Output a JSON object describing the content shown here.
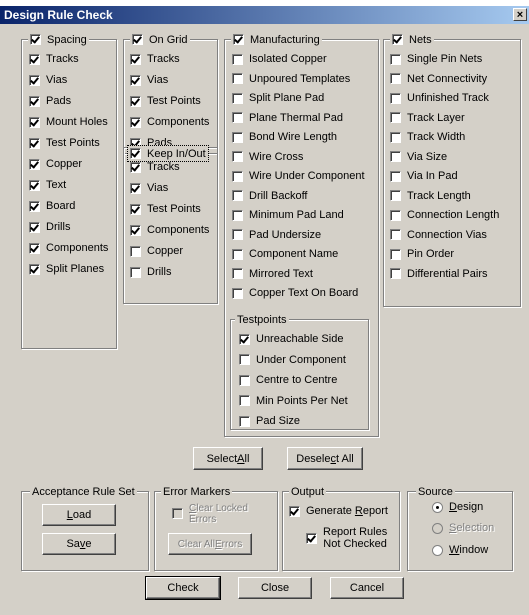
{
  "title": "Design Rule Check",
  "close_glyph": "×",
  "spacing": {
    "header": "Spacing",
    "items": [
      "Tracks",
      "Vias",
      "Pads",
      "Mount Holes",
      "Test Points",
      "Copper",
      "Text",
      "Board",
      "Drills",
      "Components",
      "Split Planes"
    ]
  },
  "ongrid": {
    "header": "On Grid",
    "items": [
      "Tracks",
      "Vias",
      "Test Points",
      "Components",
      "Pads"
    ]
  },
  "keepin": {
    "header": "Keep In/Out",
    "items": [
      "Tracks",
      "Vias",
      "Test Points",
      "Components",
      "Copper",
      "Drills"
    ],
    "checked": [
      true,
      true,
      true,
      true,
      false,
      false
    ]
  },
  "manufacturing": {
    "header": "Manufacturing",
    "items": [
      "Isolated Copper",
      "Unpoured Templates",
      "Split Plane Pad",
      "Plane Thermal Pad",
      "Bond Wire Length",
      "Wire Cross",
      "Wire Under Component",
      "Drill Backoff",
      "Minimum Pad Land",
      "Pad Undersize",
      "Component Name",
      "Mirrored Text",
      "Copper Text On Board"
    ]
  },
  "testpoints": {
    "header": "Testpoints",
    "items": [
      "Unreachable Side",
      "Under Component",
      "Centre to Centre",
      "Min Points Per Net",
      "Pad Size"
    ],
    "checked": [
      true,
      false,
      false,
      false,
      false
    ]
  },
  "nets": {
    "header": "Nets",
    "items": [
      "Single Pin Nets",
      "Net Connectivity",
      "Unfinished Track",
      "Track Layer",
      "Track Width",
      "Via Size",
      "Via In Pad",
      "Track Length",
      "Connection Length",
      "Connection Vias",
      "Pin Order",
      "Differential Pairs"
    ]
  },
  "select_all": {
    "pre": "Select ",
    "u": "A",
    "post": "ll"
  },
  "deselect_all": {
    "pre": "Desele",
    "u": "c",
    "post": "t All"
  },
  "acceptance": {
    "header": "Acceptance Rule Set",
    "load": {
      "u": "L",
      "post": "oad"
    },
    "save": {
      "pre": "Sa",
      "u": "v",
      "post": "e"
    }
  },
  "error_markers": {
    "header": "Error Markers",
    "clear_locked": {
      "u": "C",
      "post1": "lear Locked",
      "line2": "Errors"
    },
    "clear_all": {
      "pre": "Clear All ",
      "u": "E",
      "post": "rrors"
    }
  },
  "output": {
    "header": "Output",
    "generate": {
      "pre": "Generate ",
      "u": "R",
      "post": "eport"
    },
    "report_rules": {
      "line1": "Report Rules",
      "line2": "Not Checked"
    }
  },
  "source": {
    "header": "Source",
    "design": {
      "u": "D",
      "post": "esign"
    },
    "selection": {
      "u": "S",
      "post": "election"
    },
    "window": {
      "u": "W",
      "post": "indow"
    }
  },
  "check_label": "Check",
  "close_label": "Close",
  "cancel_label": "Cancel"
}
